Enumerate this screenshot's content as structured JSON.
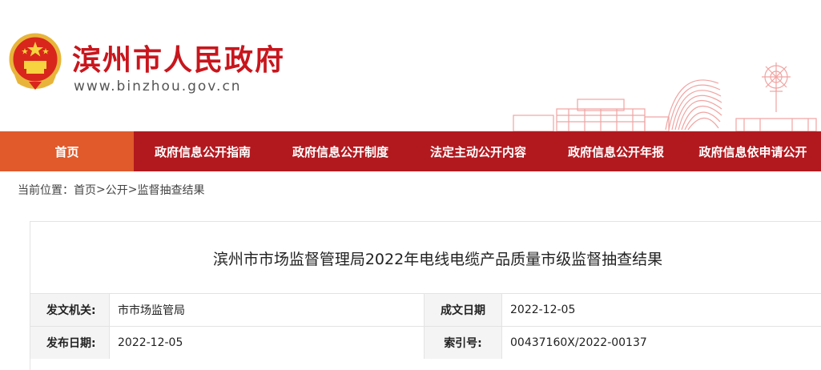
{
  "site": {
    "title": "滨州市人民政府",
    "url": "www.binzhou.gov.cn"
  },
  "nav": {
    "items": [
      "首页",
      "政府信息公开指南",
      "政府信息公开制度",
      "法定主动公开内容",
      "政府信息公开年报",
      "政府信息依申请公开"
    ]
  },
  "breadcrumb": {
    "prefix": "当前位置：",
    "home": "首页",
    "section": "公开",
    "current": "监督抽查结果",
    "separator": ">"
  },
  "article": {
    "title": "滨州市市场监督管理局2022年电线电缆产品质量市级监督抽查结果",
    "meta": {
      "issuer_label": "发文机关:",
      "issuer_value": "市市场监管局",
      "created_label": "成文日期",
      "created_value": "2022-12-05",
      "published_label": "发布日期:",
      "published_value": "2022-12-05",
      "index_label": "索引号:",
      "index_value": "00437160X/2022-00137"
    }
  },
  "colors": {
    "brand_red": "#c8161d",
    "nav_red": "#b2191f",
    "nav_active": "#e05a2b"
  },
  "icons": {
    "emblem": "national-emblem-icon",
    "skyline": "city-skyline-decoration"
  }
}
